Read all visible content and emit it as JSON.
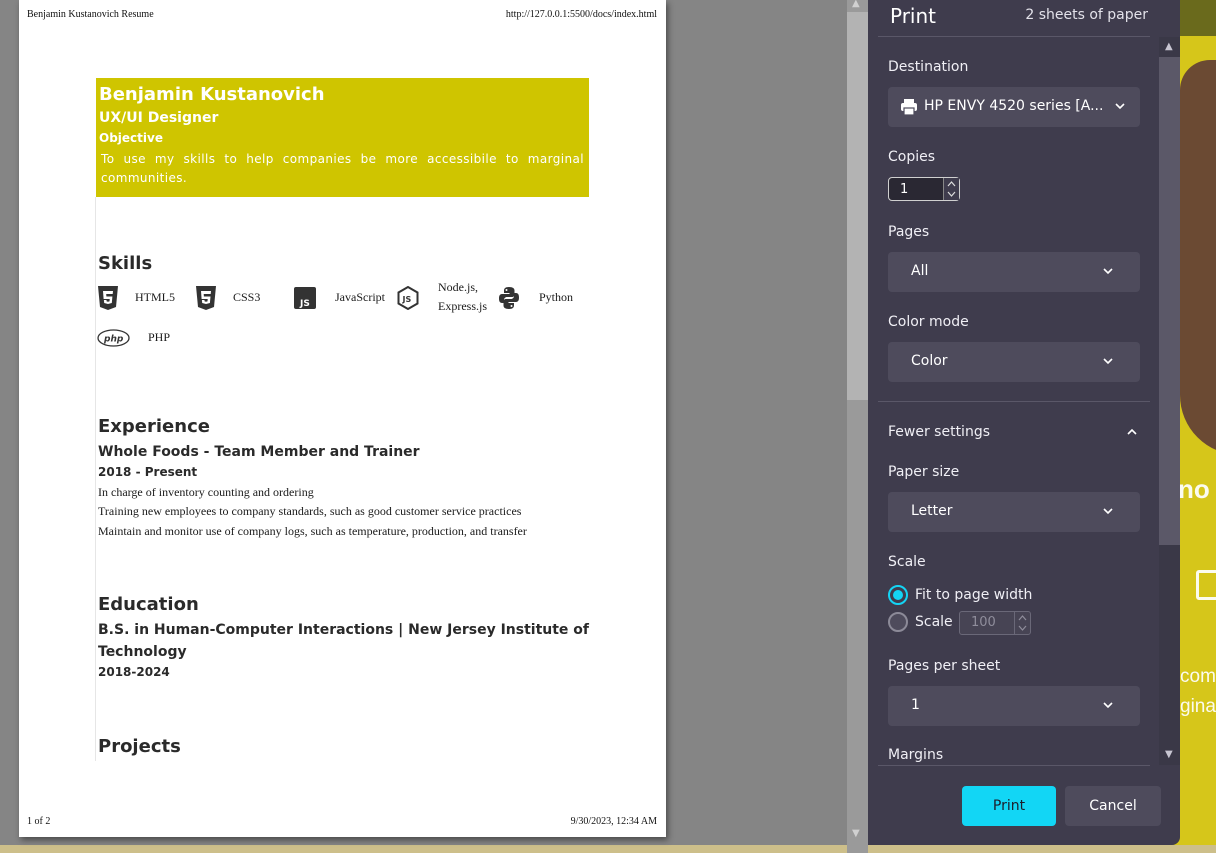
{
  "preview": {
    "header_left": "Benjamin Kustanovich Resume",
    "header_right": "http://127.0.0.1:5500/docs/index.html",
    "footer_left": "1 of 2",
    "footer_right": "9/30/2023, 12:34 AM"
  },
  "resume": {
    "name": "Benjamin Kustanovich",
    "role": "UX/UI Designer",
    "objective_heading": "Objective",
    "objective_text": "To use my skills to help companies be more accessibile to marginal communities.",
    "skills_heading": "Skills",
    "skills": [
      {
        "icon": "html5-icon",
        "label": "HTML5"
      },
      {
        "icon": "css3-icon",
        "label": "CSS3"
      },
      {
        "icon": "javascript-icon",
        "label": "JavaScript"
      },
      {
        "icon": "nodejs-icon",
        "label_line1": "Node.js,",
        "label_line2": "Express.js"
      },
      {
        "icon": "python-icon",
        "label": "Python"
      },
      {
        "icon": "php-icon",
        "label": "PHP"
      }
    ],
    "experience_heading": "Experience",
    "experience": {
      "title": "Whole Foods - Team Member and Trainer",
      "dates": "2018 - Present",
      "bullets": [
        "In charge of inventory counting and ordering",
        "Training new employees to company standards, such as good customer service practices",
        "Maintain and monitor use of company logs, such as temperature, production, and transfer"
      ]
    },
    "education_heading": "Education",
    "education": {
      "line1": "B.S. in Human-Computer Interactions | New Jersey Institute of",
      "line2": "Technology",
      "dates": "2018-2024"
    },
    "projects_heading": "Projects"
  },
  "print_panel": {
    "title": "Print",
    "sheets": "2 sheets of paper",
    "destination_label": "Destination",
    "destination_value": "HP ENVY 4520 series [A...",
    "copies_label": "Copies",
    "copies_value": "1",
    "pages_label": "Pages",
    "pages_value": "All",
    "color_mode_label": "Color mode",
    "color_mode_value": "Color",
    "fewer_settings": "Fewer settings",
    "paper_size_label": "Paper size",
    "paper_size_value": "Letter",
    "scale_label": "Scale",
    "fit_option": "Fit to page width",
    "scale_option": "Scale",
    "scale_value": "100",
    "pages_per_sheet_label": "Pages per sheet",
    "pages_per_sheet_value": "1",
    "margins_label": "Margins",
    "print_button": "Print",
    "cancel_button": "Cancel"
  },
  "background_page": {
    "text1": "no",
    "text2_line1": "com",
    "text2_line2": "gina"
  },
  "colors": {
    "accent": "#12d6f5",
    "resume_header": "#cfc500",
    "panel_bg": "#3f3c4d"
  }
}
